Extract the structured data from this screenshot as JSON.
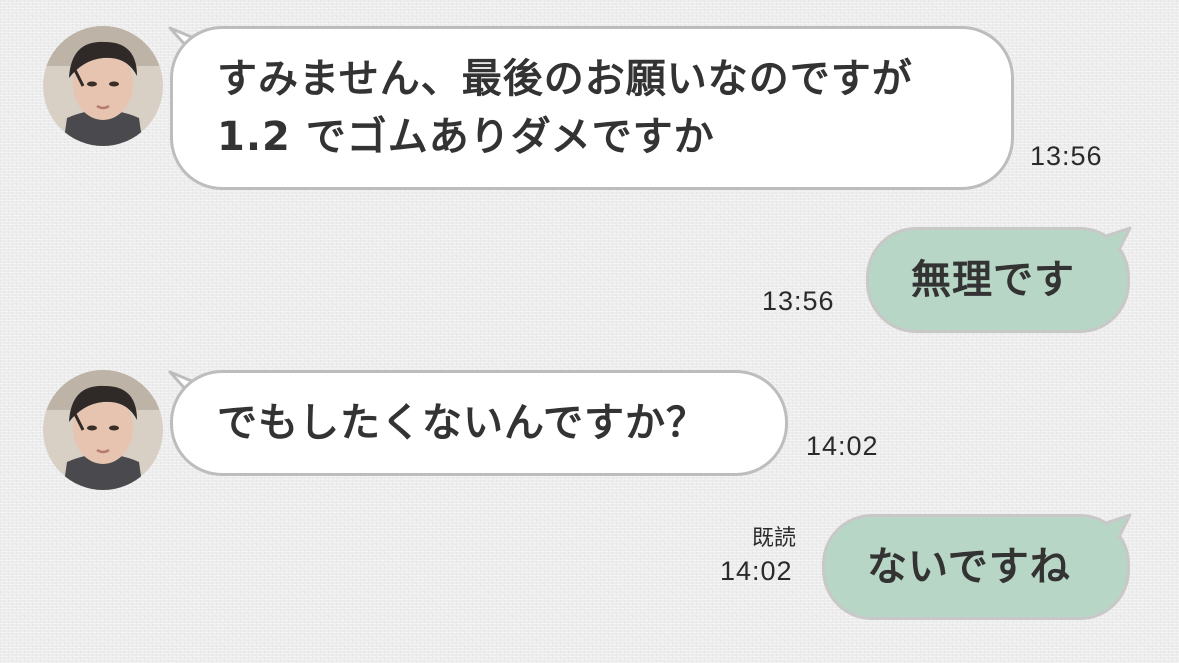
{
  "messages": [
    {
      "sender": "other",
      "text": "すみません、最後のお願いなのですが\n1.2 でゴムありダメですか",
      "time": "13:56"
    },
    {
      "sender": "me",
      "text": "無理です",
      "time": "13:56"
    },
    {
      "sender": "other",
      "text": "でもしたくないんですか？",
      "time": "14:02"
    },
    {
      "sender": "me",
      "text": "ないですね",
      "time": "14:02",
      "read_label": "既読"
    }
  ],
  "colors": {
    "incoming_bubble": "#ffffff",
    "outgoing_bubble": "#b8d6c6",
    "bubble_border": "#bdbdbd",
    "text": "#333333",
    "background": "#eeeeee"
  },
  "icons": {
    "avatar": "user-avatar-photo"
  }
}
